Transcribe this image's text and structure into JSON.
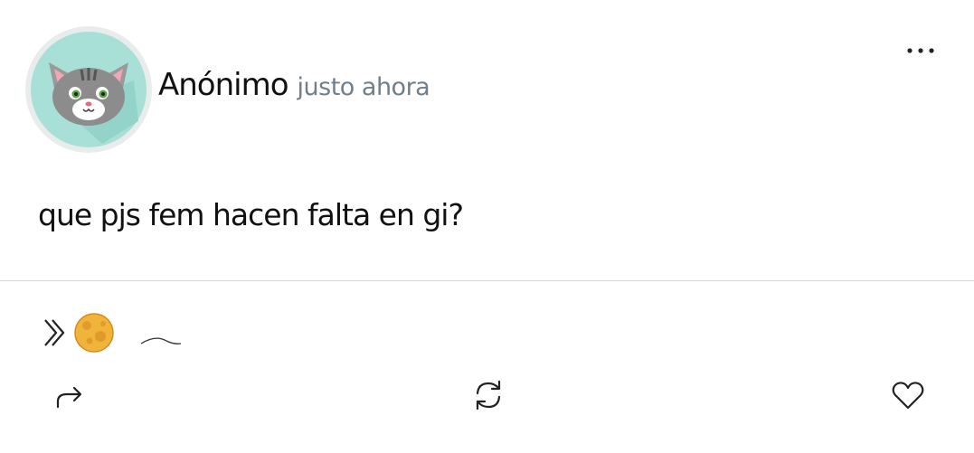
{
  "post": {
    "author": "Anónimo",
    "time": "justo ahora",
    "body": "que pjs fem hacen falta en gi?"
  },
  "icons": {
    "avatar": "cat-avatar-icon",
    "more": "more-options-icon",
    "reactions_expand": "double-chevron-right-icon",
    "reaction_emoji": "full-moon-emoji-icon",
    "reaction_squiggle": "tilde-squiggle-icon",
    "share": "share-arrow-icon",
    "reblog": "reblog-refresh-icon",
    "like": "heart-outline-icon"
  },
  "colors": {
    "avatar_bg": "#a8e0d8",
    "avatar_ring": "#e9ecec",
    "time_text": "#6f7f8b",
    "divider": "#d7d7d7",
    "icon_stroke": "#222222"
  }
}
